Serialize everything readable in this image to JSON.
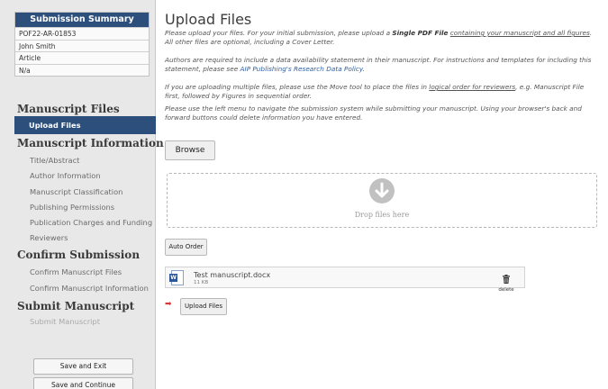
{
  "sidebar": {
    "summary": {
      "header": "Submission Summary",
      "rows": [
        "POF22-AR-01853",
        "John Smith",
        "Article",
        "N/a"
      ]
    },
    "sections": {
      "manuscript_files": {
        "title": "Manuscript Files",
        "items": [
          "Upload Files"
        ]
      },
      "manuscript_information": {
        "title": "Manuscript Information",
        "items": [
          "Title/Abstract",
          "Author Information",
          "Manuscript Classification",
          "Publishing Permissions",
          "Publication Charges and Funding",
          "Reviewers"
        ]
      },
      "confirm_submission": {
        "title": "Confirm Submission",
        "items": [
          "Confirm Manuscript Files",
          "Confirm Manuscript Information"
        ]
      },
      "submit_manuscript": {
        "title": "Submit Manuscript",
        "items": [
          "Submit Manuscript"
        ]
      }
    },
    "buttons": {
      "save_exit": "Save and Exit",
      "save_continue": "Save and Continue"
    }
  },
  "main": {
    "title": "Upload Files",
    "p1": {
      "a": "Please upload your files. For your initial submission, please upload a ",
      "b": "Single PDF File",
      "c": " ",
      "d": "containing your manuscript and all figures",
      "e": ". All other files are optional, including a Cover Letter."
    },
    "p2": {
      "a": "Authors are required to include a data availability statement in their manuscript. For instructions and templates for including this statement, please see ",
      "link": "AIP Publishing's Research Data Policy",
      "b": "."
    },
    "p3": {
      "a": "If you are uploading multiple files, please use the Move tool to place the files in ",
      "b": "logical order for reviewers",
      "c": ", e.g. Manuscript File first, followed by Figures in sequential order."
    },
    "p4": "Please use the left menu to navigate the submission system while submitting your manuscript. Using your browser's back and forward buttons could delete information you have entered.",
    "browse_label": "Browse",
    "drop_text": "Drop files here",
    "auto_order_label": "Auto Order",
    "file": {
      "name": "Test manuscript.docx",
      "size": "11 KB",
      "delete_label": "delete",
      "icon": "word-document-icon"
    },
    "upload_label": "Upload Files"
  },
  "colors": {
    "nav_blue": "#2c4f7c",
    "link_blue": "#2f5f9f",
    "arrow_red": "#d83636",
    "word_blue": "#2b579a"
  }
}
